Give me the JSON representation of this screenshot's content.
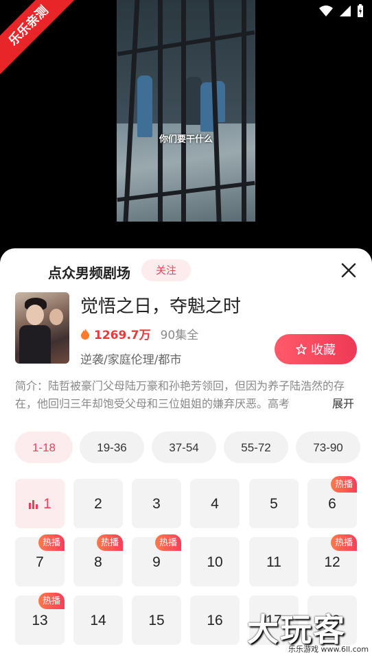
{
  "watermark_ribbon": "乐乐亲测",
  "video": {
    "subtitle": "你们要干什么"
  },
  "header": {
    "title": "点众男频剧场",
    "follow_label": "关注"
  },
  "book": {
    "title": "觉悟之日，夺魁之时",
    "heat": "1269.7万",
    "episodes": "90集全",
    "tags": "逆袭/家庭伦理/都市",
    "collect_label": "收藏"
  },
  "intro": {
    "text": "简介：陆哲被豪门父母陆万豪和孙艳芳领回，但因为养子陆浩然的存在，他回归三年却饱受父母和三位姐姐的嫌弃厌恶。高考",
    "expand_label": "展开"
  },
  "ranges": [
    "1-18",
    "19-36",
    "37-54",
    "55-72",
    "73-90"
  ],
  "episodes": [
    {
      "n": "1",
      "hot": false
    },
    {
      "n": "2",
      "hot": false
    },
    {
      "n": "3",
      "hot": false
    },
    {
      "n": "4",
      "hot": false
    },
    {
      "n": "5",
      "hot": false
    },
    {
      "n": "6",
      "hot": true
    },
    {
      "n": "7",
      "hot": true
    },
    {
      "n": "8",
      "hot": true
    },
    {
      "n": "9",
      "hot": true
    },
    {
      "n": "10",
      "hot": false
    },
    {
      "n": "11",
      "hot": false
    },
    {
      "n": "12",
      "hot": true
    },
    {
      "n": "13",
      "hot": true
    },
    {
      "n": "14",
      "hot": false
    },
    {
      "n": "15",
      "hot": false
    },
    {
      "n": "16",
      "hot": false
    },
    {
      "n": "17",
      "hot": false
    },
    {
      "n": "18",
      "hot": false
    }
  ],
  "hot_label": "热播",
  "bottom_watermark": {
    "big": "大玩客",
    "small": "乐乐游戏 www.6ll.com"
  },
  "colors": {
    "accent": "#ef3e5a",
    "accent_bg": "#fdecee"
  }
}
